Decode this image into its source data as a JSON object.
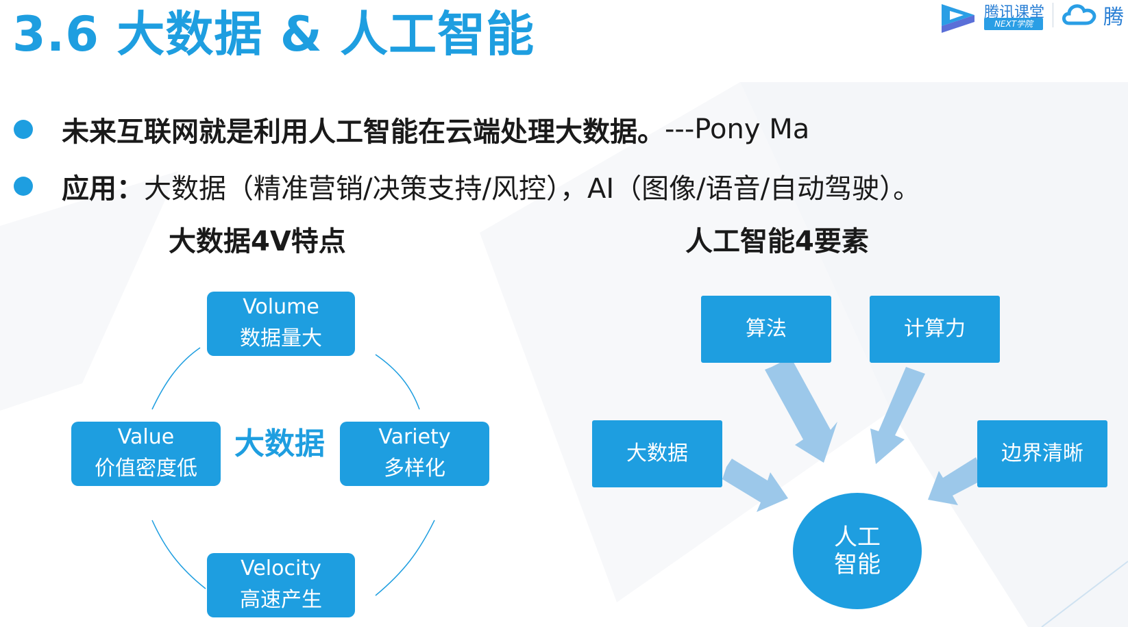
{
  "slide": {
    "title": "3.6 大数据 & 人工智能",
    "logo": {
      "brand": "腾讯课堂",
      "sub": "NEXT学院",
      "cloud_text": "腾"
    },
    "bullets": [
      {
        "bold": "未来互联网就是利用人工智能在云端处理大数据。",
        "text": "---Pony Ma"
      },
      {
        "bold": "应用：",
        "text": "大数据（精准营销/决策支持/风控），AI（图像/语音/自动驾驶）。"
      }
    ]
  },
  "bigdata": {
    "heading": "大数据4V特点",
    "center": "大数据",
    "items": [
      {
        "en": "Volume",
        "zh": "数据量大"
      },
      {
        "en": "Variety",
        "zh": "多样化"
      },
      {
        "en": "Velocity",
        "zh": "高速产生"
      },
      {
        "en": "Value",
        "zh": "价值密度低"
      }
    ]
  },
  "ai": {
    "heading": "人工智能4要素",
    "boxes": {
      "algorithm": "算法",
      "compute": "计算力",
      "bigdata": "大数据",
      "boundary": "边界清晰"
    },
    "center": "人工智能"
  },
  "colors": {
    "accent": "#1e9ee0",
    "arrow": "#9cc8ea",
    "decor": "#f3f5f8"
  }
}
